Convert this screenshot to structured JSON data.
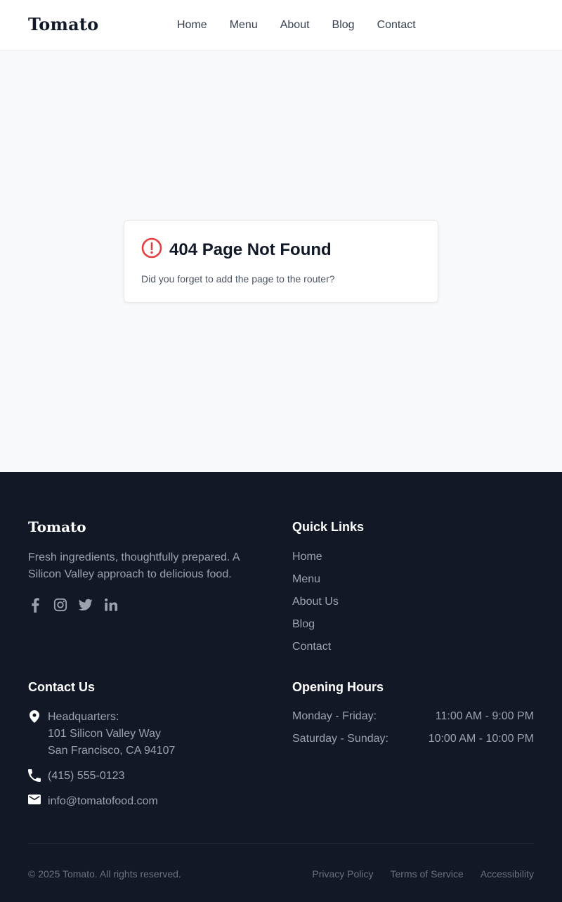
{
  "header": {
    "brand": "Tomato",
    "nav": [
      "Home",
      "Menu",
      "About",
      "Blog",
      "Contact"
    ]
  },
  "error_card": {
    "icon": "alert-circle-icon",
    "title": "404 Page Not Found",
    "description": "Did you forget to add the page to the router?"
  },
  "footer": {
    "brand": "Tomato",
    "tagline": "Fresh ingredients, thoughtfully prepared. A Silicon Valley approach to delicious food.",
    "social_icons": [
      "facebook-icon",
      "instagram-icon",
      "twitter-icon",
      "linkedin-icon"
    ],
    "quick_links": {
      "heading": "Quick Links",
      "items": [
        "Home",
        "Menu",
        "About Us",
        "Blog",
        "Contact"
      ]
    },
    "contact": {
      "heading": "Contact Us",
      "address_label": "Headquarters:",
      "address_line1": "101 Silicon Valley Way",
      "address_line2": "San Francisco, CA 94107",
      "phone": "(415) 555-0123",
      "email": "info@tomatofood.com"
    },
    "hours": {
      "heading": "Opening Hours",
      "rows": [
        {
          "days": "Monday - Friday:",
          "time": "11:00 AM - 9:00 PM"
        },
        {
          "days": "Saturday - Sunday:",
          "time": "10:00 AM - 10:00 PM"
        }
      ]
    },
    "copyright": "© 2025 Tomato. All rights reserved.",
    "legal_links": [
      "Privacy Policy",
      "Terms of Service",
      "Accessibility"
    ]
  },
  "colors": {
    "error_accent": "#e53e3e",
    "footer_bg": "#121826"
  }
}
